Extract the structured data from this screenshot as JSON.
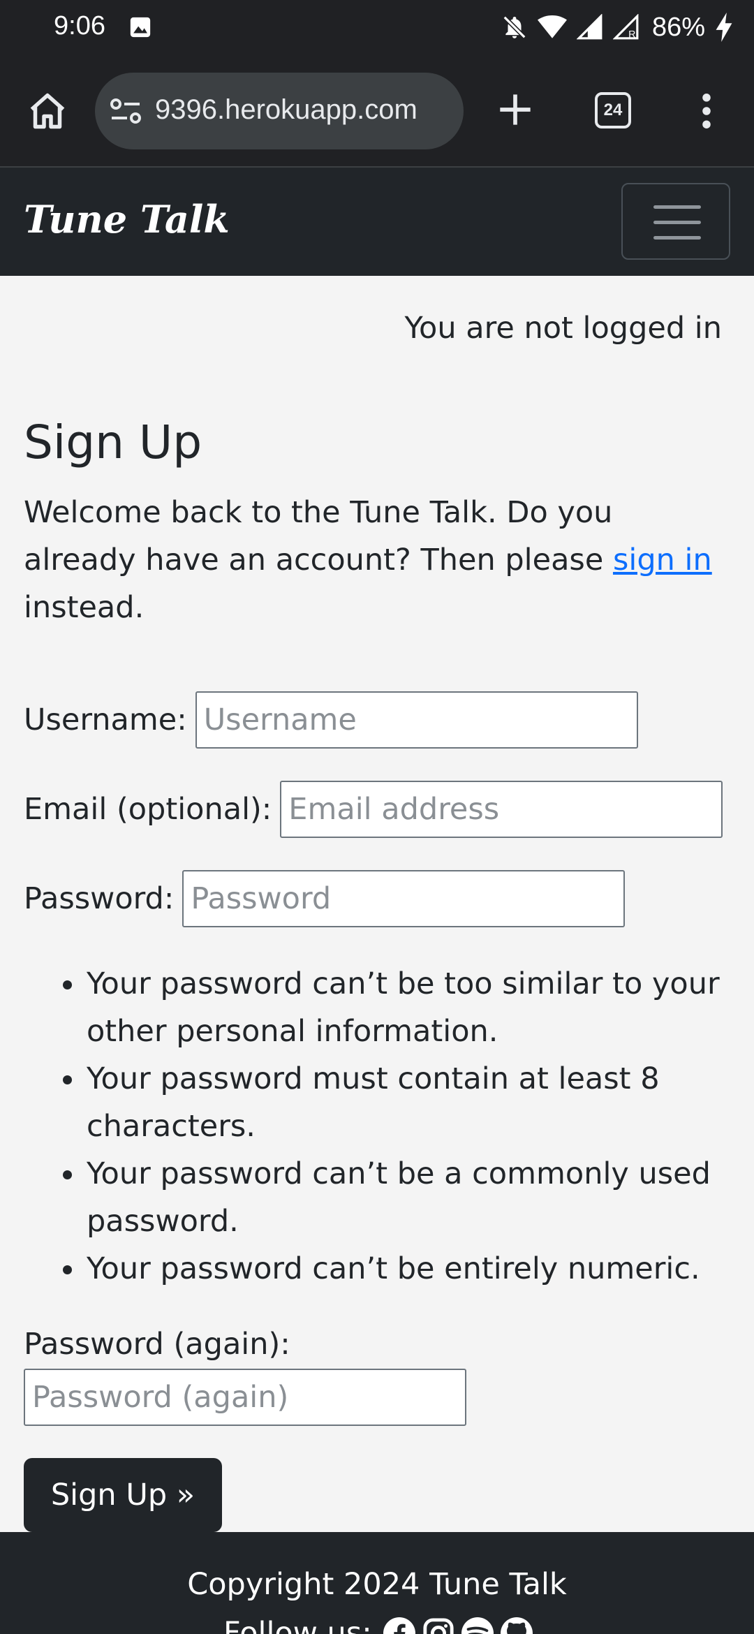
{
  "status_bar": {
    "time": "9:06",
    "battery": "86%",
    "icons": [
      "gallery-icon",
      "bell-off-icon",
      "wifi-icon",
      "signal-icon",
      "signal-roaming-icon",
      "charging-icon"
    ]
  },
  "browser": {
    "url": "9396.herokuapp.com",
    "tab_count": "24",
    "icons": [
      "home-icon",
      "site-settings-icon",
      "plus-icon",
      "tabs-icon",
      "more-vert-icon"
    ]
  },
  "navbar": {
    "brand": "Tune Talk",
    "toggler_icon": "hamburger-icon"
  },
  "auth_status": "You are not logged in",
  "page": {
    "title": "Sign Up",
    "intro_before": "Welcome back to the Tune Talk. Do you already have an account? Then please ",
    "intro_link": "sign in",
    "intro_after": " instead."
  },
  "form": {
    "username": {
      "label": "Username:",
      "placeholder": "Username",
      "value": ""
    },
    "email": {
      "label": "Email (optional):",
      "placeholder": "Email address",
      "value": ""
    },
    "password": {
      "label": "Password:",
      "placeholder": "Password",
      "value": ""
    },
    "password_help": [
      "Your password can’t be too similar to your other personal information.",
      "Your password must contain at least 8 characters.",
      "Your password can’t be a commonly used password.",
      "Your password can’t be entirely numeric."
    ],
    "password_again": {
      "label": "Password (again):",
      "placeholder": "Password (again)",
      "value": ""
    },
    "submit_label": "Sign Up »"
  },
  "footer": {
    "copyright": "Copyright 2024 Tune Talk",
    "follow_label": "Follow us:",
    "social_icons": [
      "facebook-icon",
      "instagram-icon",
      "spotify-icon",
      "github-icon"
    ]
  },
  "colors": {
    "dark": "#212529",
    "chrome": "#202124",
    "link": "#0d6efd",
    "page_bg": "#f4f4f4"
  }
}
